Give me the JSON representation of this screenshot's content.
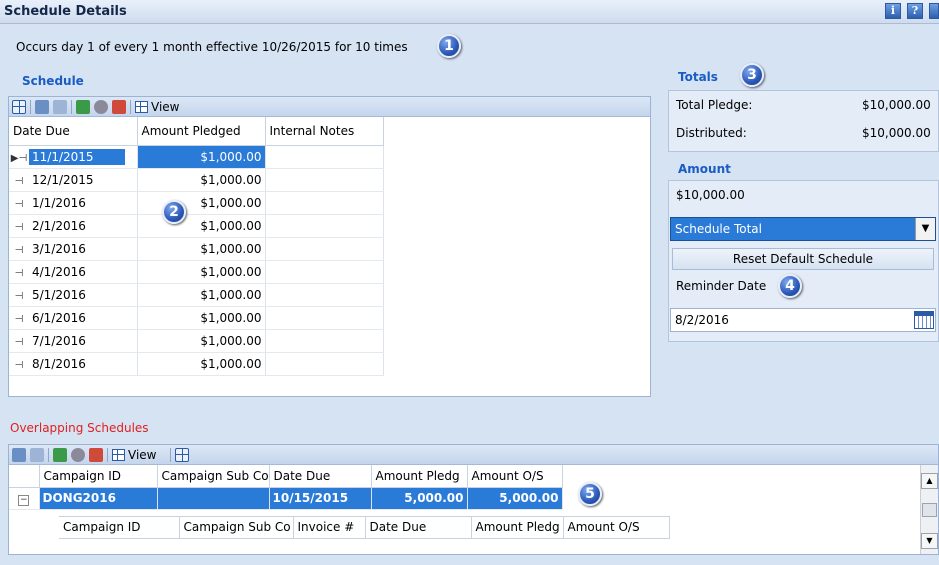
{
  "header": {
    "title": "Schedule Details"
  },
  "occurs_text": "Occurs day 1 of every 1 month effective 10/26/2015 for 10  times",
  "badges": [
    "1",
    "2",
    "3",
    "4",
    "5"
  ],
  "schedule": {
    "label": "Schedule",
    "toolbar": {
      "view_label": "View"
    },
    "columns": [
      "Date Due",
      "Amount Pledged",
      "Internal Notes"
    ],
    "rows": [
      {
        "date": "11/1/2015",
        "amount": "$1,000.00",
        "notes": ""
      },
      {
        "date": "12/1/2015",
        "amount": "$1,000.00",
        "notes": ""
      },
      {
        "date": "1/1/2016",
        "amount": "$1,000.00",
        "notes": ""
      },
      {
        "date": "2/1/2016",
        "amount": "$1,000.00",
        "notes": ""
      },
      {
        "date": "3/1/2016",
        "amount": "$1,000.00",
        "notes": ""
      },
      {
        "date": "4/1/2016",
        "amount": "$1,000.00",
        "notes": ""
      },
      {
        "date": "5/1/2016",
        "amount": "$1,000.00",
        "notes": ""
      },
      {
        "date": "6/1/2016",
        "amount": "$1,000.00",
        "notes": ""
      },
      {
        "date": "7/1/2016",
        "amount": "$1,000.00",
        "notes": ""
      },
      {
        "date": "8/1/2016",
        "amount": "$1,000.00",
        "notes": ""
      }
    ]
  },
  "totals": {
    "label": "Totals",
    "total_pledge_label": "Total Pledge:",
    "total_pledge_value": "$10,000.00",
    "distributed_label": "Distributed:",
    "distributed_value": "$10,000.00"
  },
  "amount": {
    "label": "Amount",
    "value": "$10,000.00",
    "dropdown_selected": "Schedule Total",
    "reset_button_label": "Reset Default Schedule",
    "reminder_label": "Reminder Date",
    "reminder_value": "8/2/2016"
  },
  "overlapping": {
    "label": "Overlapping Schedules",
    "toolbar": {
      "view_label": "View"
    },
    "columns": [
      "Campaign ID",
      "Campaign Sub Co",
      "Date Due",
      "Amount Pledg",
      "Amount O/S"
    ],
    "row": {
      "campaign_id": "DONG2016",
      "campaign_sub": "",
      "date_due": "10/15/2015",
      "amount_pledged": "5,000.00",
      "amount_os": "5,000.00"
    },
    "child_columns": [
      "Campaign ID",
      "Campaign Sub Co",
      "Invoice #",
      "Date Due",
      "Amount Pledg",
      "Amount O/S"
    ]
  },
  "icons": [
    "info-icon",
    "help-icon",
    "extra-icon",
    "grid-icon",
    "view-icon",
    "calendar-icon",
    "excel-icon",
    "print-icon",
    "search-icon",
    "pin-icon",
    "expander-icon"
  ]
}
